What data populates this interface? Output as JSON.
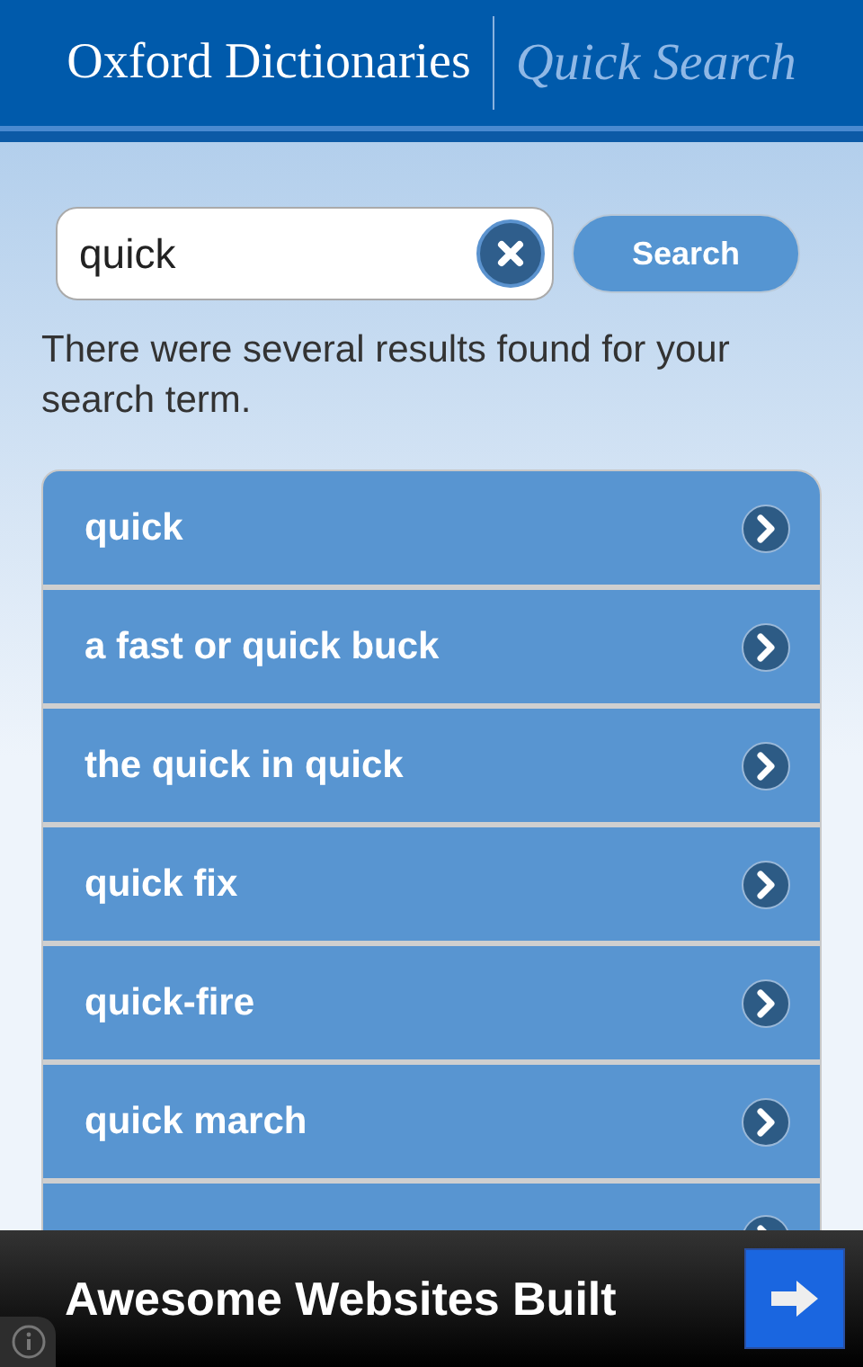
{
  "header": {
    "brand": "Oxford Dictionaries",
    "product": "Quick Search"
  },
  "search": {
    "value": "quick",
    "button": "Search"
  },
  "message": "There were several results found for your search term.",
  "results": [
    {
      "kind": "entry",
      "label": "quick"
    },
    {
      "kind": "entry",
      "label": "a fast or quick buck"
    },
    {
      "kind": "entry",
      "label": "the quick in quick"
    },
    {
      "kind": "entry",
      "label": "quick fix"
    },
    {
      "kind": "entry",
      "label": "quick-fire"
    },
    {
      "kind": "entry",
      "label": "quick march"
    },
    {
      "kind": "covered"
    }
  ],
  "ad": {
    "text": "Awesome Websites Built"
  }
}
